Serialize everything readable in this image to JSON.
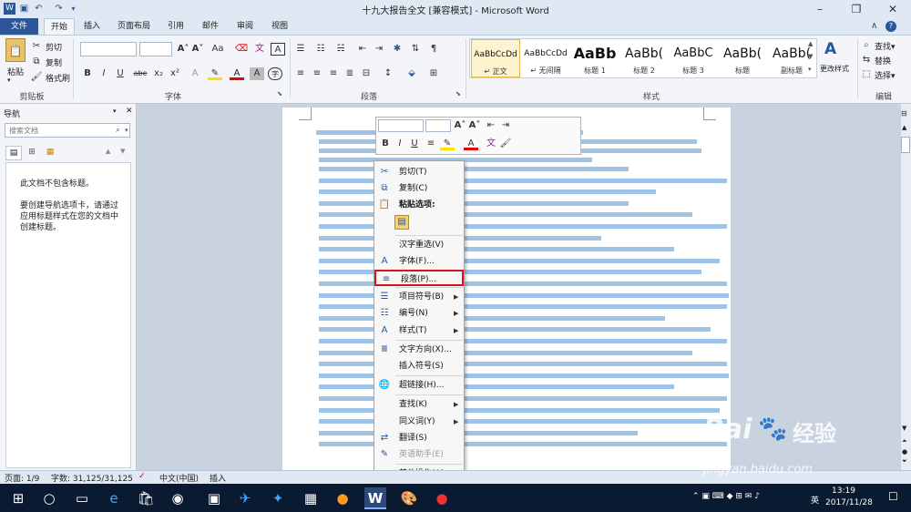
{
  "window": {
    "title": "十九大报告全文 [兼容模式] - Microsoft Word"
  },
  "tabs": [
    "文件",
    "开始",
    "插入",
    "页面布局",
    "引用",
    "邮件",
    "审阅",
    "视图"
  ],
  "clipboard": {
    "paste": "粘贴",
    "cut": "剪切",
    "copy": "复制",
    "format_painter": "格式刷",
    "group": "剪贴板"
  },
  "font_group": {
    "group": "字体",
    "bold": "B",
    "italic": "I",
    "underline": "U",
    "strike": "abe",
    "sub": "x₂",
    "sup": "x²",
    "grow": "A˄",
    "shrink": "A˅",
    "aa": "Aa",
    "clear": "A",
    "font_color": "A",
    "char_border": "A"
  },
  "paragraph_group": {
    "group": "段落"
  },
  "styles": [
    {
      "preview": "AaBbCcDd",
      "name": "↵ 正文"
    },
    {
      "preview": "AaBbCcDd",
      "name": "↵ 无间隔"
    },
    {
      "preview": "AaBb",
      "name": "标题 1"
    },
    {
      "preview": "AaBb(",
      "name": "标题 2"
    },
    {
      "preview": "AaBbC",
      "name": "标题 3"
    },
    {
      "preview": "AaBb(",
      "name": "标题"
    },
    {
      "preview": "AaBb(",
      "name": "副标题"
    }
  ],
  "styles_group": "样式",
  "change_styles": "更改样式",
  "editing": {
    "find": "查找▾",
    "replace": "替换",
    "select": "选择▾",
    "group": "编辑"
  },
  "nav": {
    "title": "导航",
    "search_placeholder": "搜索文档",
    "msg1": "此文档不包含标题。",
    "msg2": "要创建导航选项卡，请通过应用标题样式在您的文档中创建标题。"
  },
  "mini_toolbar": {
    "bold": "B",
    "italic": "I",
    "underline": "U",
    "grow": "A˄",
    "shrink": "A˅"
  },
  "context_menu": [
    {
      "label": "剪切(T)",
      "icon": "scissors-icon",
      "glyph": "✂"
    },
    {
      "label": "复制(C)",
      "icon": "copy-icon",
      "glyph": "⧉"
    },
    {
      "label": "粘贴选项:",
      "icon": "paste-icon",
      "glyph": "📋",
      "bold": true
    },
    {
      "label": "",
      "icon": "paste-keep-icon",
      "glyph": "▤"
    },
    {
      "label": "汉字重选(V)",
      "icon": "",
      "glyph": ""
    },
    {
      "label": "字体(F)...",
      "icon": "font-icon",
      "glyph": "A"
    },
    {
      "label": "段落(P)...",
      "icon": "paragraph-icon",
      "glyph": "≡"
    },
    {
      "label": "项目符号(B)",
      "icon": "bullets-icon",
      "glyph": "☰",
      "sub": true
    },
    {
      "label": "编号(N)",
      "icon": "numbering-icon",
      "glyph": "☷",
      "sub": true
    },
    {
      "label": "样式(T)",
      "icon": "styles-icon",
      "glyph": "A",
      "sub": true
    },
    {
      "label": "文字方向(X)...",
      "icon": "text-direction-icon",
      "glyph": "Ⅲ"
    },
    {
      "label": "插入符号(S)",
      "icon": "",
      "glyph": ""
    },
    {
      "label": "超链接(H)...",
      "icon": "hyperlink-icon",
      "glyph": "🌐"
    },
    {
      "label": "查找(K)",
      "icon": "",
      "glyph": "",
      "sub": true
    },
    {
      "label": "同义词(Y)",
      "icon": "",
      "glyph": "",
      "sub": true
    },
    {
      "label": "翻译(S)",
      "icon": "translate-icon",
      "glyph": "⇄"
    },
    {
      "label": "英语助手(E)",
      "icon": "english-assistant-icon",
      "glyph": "✎",
      "disabled": true
    },
    {
      "label": "其他操作(A)",
      "icon": "",
      "glyph": "",
      "sub": true
    }
  ],
  "status": {
    "page": "页面: 1/9",
    "words": "字数: 31,125/31,125",
    "lang": "中文(中国)",
    "mode": "插入"
  },
  "taskbar": {
    "time": "13:19",
    "date": "2017/11/28",
    "ime": "英"
  },
  "watermark": {
    "brand": "Bai",
    "brand2": "经验",
    "url": "jingyan.baidu.com"
  }
}
